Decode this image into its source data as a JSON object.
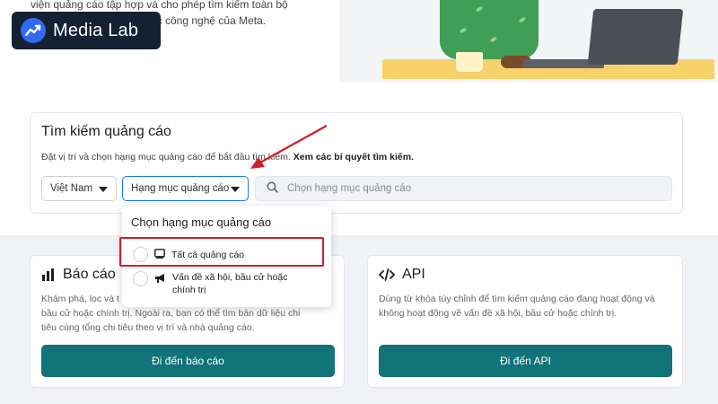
{
  "hero": {
    "text_line1": "viện quảng cáo tập hợp và cho phép tìm kiếm toàn bộ",
    "text_line2": "các công nghệ của Meta."
  },
  "logo": {
    "name": "Media Lab",
    "icon": "trend-up-icon",
    "color": "#2f6bf6"
  },
  "search": {
    "title": "Tìm kiếm quảng cáo",
    "subtitle": "Đặt vị trí và chọn hạng mục quảng cáo để bắt đầu tìm kiếm.",
    "tips_link": "Xem các bí quyết tìm kiếm.",
    "country_value": "Việt Nam",
    "category_value": "Hạng mục quảng cáo",
    "input_placeholder": "Chọn hạng mục quảng cáo"
  },
  "dropdown": {
    "title": "Chọn hạng mục quảng cáo",
    "options": [
      {
        "label": "Tất cả quảng cáo",
        "icon": "ad-screen-icon"
      },
      {
        "label": "Vấn đề xã hội, bầu cử hoặc chính trị",
        "icon": "megaphone-icon"
      }
    ]
  },
  "cards": {
    "report": {
      "title": "Báo cáo",
      "icon": "bar-chart-icon",
      "line1": "Khám phá, lọc và t",
      "line2": "bầu cử hoặc chính trị. Ngoài ra, bạn có thể tìm bản dữ liệu chi",
      "line3": "tiêu cùng tổng chi tiêu theo vị trí và nhà quảng cáo.",
      "button": "Đi đến báo cáo"
    },
    "api": {
      "title": "API",
      "icon": "code-icon",
      "description": "Dùng từ khóa tùy chỉnh để tìm kiếm quảng cáo đang hoạt động và không hoạt động về vấn đề xã hội, bầu cử hoặc chính trị.",
      "button": "Đi đến API"
    }
  },
  "colors": {
    "button_teal": "#12737a",
    "annotation_red": "#d21f2a",
    "logo_bg": "#152033"
  }
}
